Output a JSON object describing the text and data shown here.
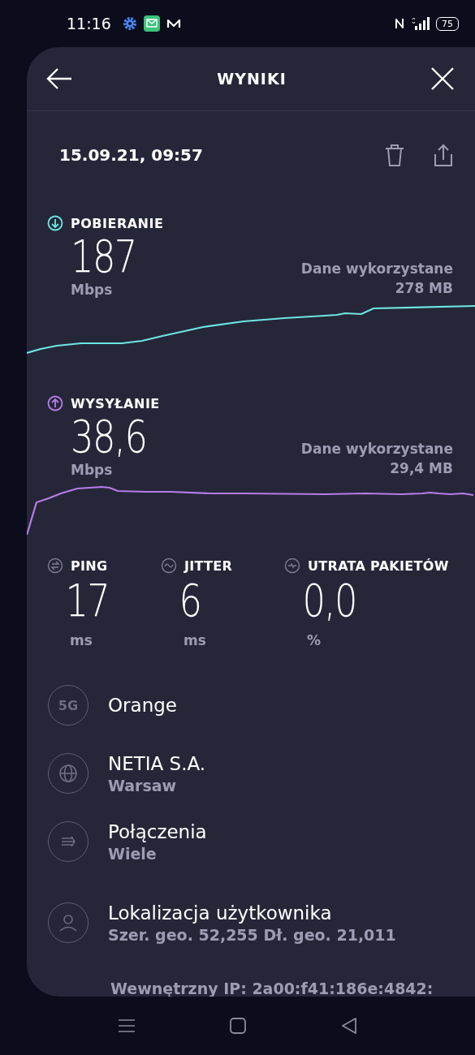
{
  "status_bar": {
    "time": "11:16",
    "battery": "75"
  },
  "header": {
    "title": "WYNIKI"
  },
  "date": "15.09.21, 09:57",
  "speeds": [
    {
      "kind": "download",
      "label": "POBIERANIE",
      "value": "187",
      "unit": "Mbps",
      "data_label": "Dane wykorzystane",
      "data_value": "278 MB",
      "color": "#6ee6e3"
    },
    {
      "kind": "upload",
      "label": "WYSYŁANIE",
      "value": "38,6",
      "unit": "Mbps",
      "data_label": "Dane wykorzystane",
      "data_value": "29,4 MB",
      "color": "#b77ce8"
    }
  ],
  "stats": [
    {
      "kind": "ping",
      "label": "PING",
      "value": "17",
      "unit": "ms"
    },
    {
      "kind": "jitter",
      "label": "JITTER",
      "value": "6",
      "unit": "ms"
    },
    {
      "kind": "loss",
      "label": "UTRATA PAKIETÓW",
      "value": "0,0",
      "unit": "%"
    }
  ],
  "details": [
    {
      "kind": "network",
      "badge": "5G",
      "title": "Orange"
    },
    {
      "kind": "server",
      "title": "NETIA S.A.",
      "subtitle": "Warsaw"
    },
    {
      "kind": "connections",
      "title": "Połączenia",
      "subtitle": "Wiele"
    },
    {
      "kind": "location",
      "title": "Lokalizacja użytkownika",
      "subtitle": "Szer. geo. 52,255 Dł. geo. 21,011"
    }
  ],
  "footer_text": "Wewnętrzny IP: 2a00:f41:186e:4842:"
}
